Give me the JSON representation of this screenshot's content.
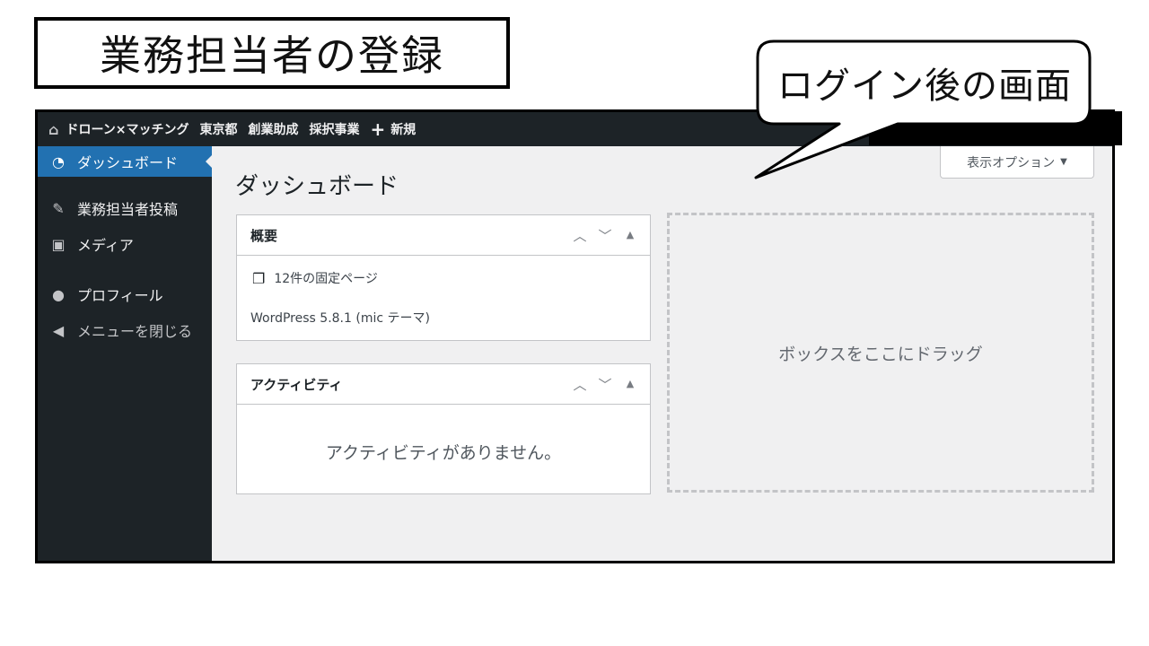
{
  "slide": {
    "title": "業務担当者の登録"
  },
  "callout": {
    "text": "ログイン後の画面"
  },
  "adminbar": {
    "site_name": "ドローン×マッチング",
    "items": [
      "東京都",
      "創業助成",
      "採択事業"
    ],
    "new_label": "新規"
  },
  "sidebar": {
    "items": [
      {
        "label": "ダッシュボード",
        "icon": "dashboard-icon",
        "active": true
      },
      {
        "label": "業務担当者投稿",
        "icon": "pin-icon"
      },
      {
        "label": "メディア",
        "icon": "media-icon"
      },
      {
        "label": "プロフィール",
        "icon": "user-icon"
      },
      {
        "label": "メニューを閉じる",
        "icon": "collapse-icon"
      }
    ]
  },
  "main": {
    "title": "ダッシュボード",
    "screen_options": "表示オプション",
    "overview": {
      "title": "概要",
      "pages_count": "12件の固定ページ",
      "version_line": "WordPress 5.8.1 (mic テーマ)"
    },
    "activity": {
      "title": "アクティビティ",
      "empty_text": "アクティビティがありません。"
    },
    "drop_zone_text": "ボックスをここにドラッグ"
  },
  "colors": {
    "adminbar_bg": "#1d2327",
    "active_menu": "#2271b1",
    "content_bg": "#f0f0f1"
  }
}
